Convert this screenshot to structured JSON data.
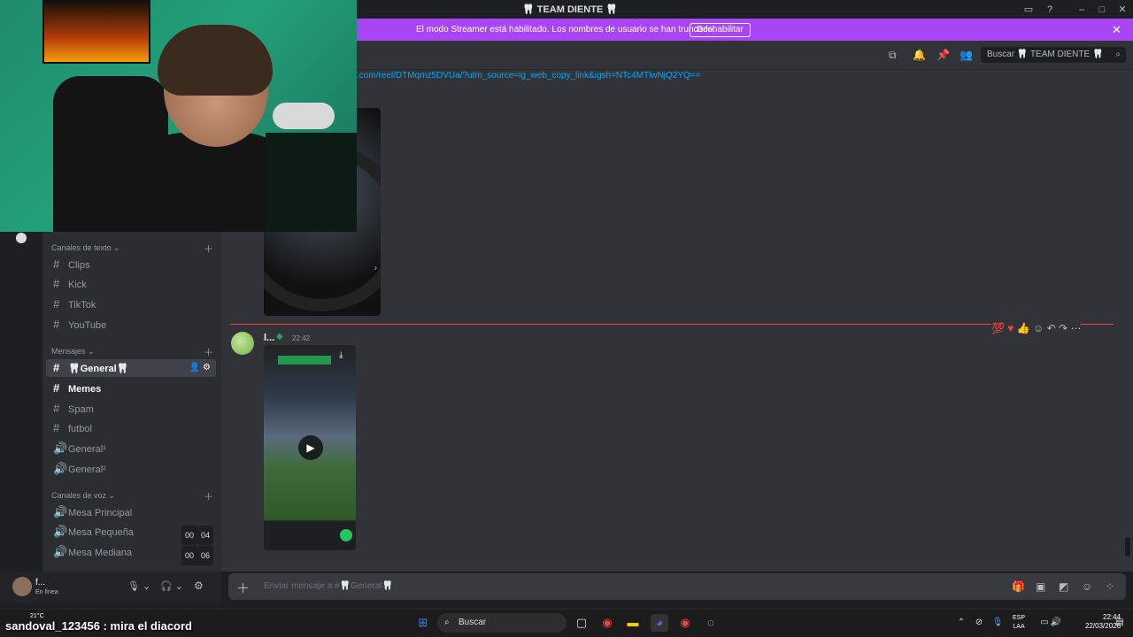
{
  "window": {
    "title": "🦷 TEAM DIENTE 🦷"
  },
  "banner": {
    "text": "El modo Streamer está habilitado. Los nombres de usuario se han truncado.",
    "button": "Deshabilitar"
  },
  "header": {
    "search_placeholder": "Buscar 🦷 TEAM DIENTE 🦷"
  },
  "sidebar": {
    "cat_text": "Canales de texto",
    "text_channels": [
      "Clips",
      "Kick",
      "TikTok",
      "YouTube"
    ],
    "cat_dm": "Mensajes",
    "dm_channels": [
      "🦷General🦷",
      "Memes",
      "Spam",
      "futbol",
      "General¹",
      "General²"
    ],
    "cat_voice": "Canales de voz",
    "voice_channels": [
      {
        "name": "Mesa Principal",
        "count": ""
      },
      {
        "name": "Mesa Pequeña",
        "count_a": "00",
        "count_b": "04"
      },
      {
        "name": "Mesa Mediana",
        "count_a": "00",
        "count_b": "06"
      }
    ]
  },
  "user": {
    "name": "f...",
    "status": "En línea"
  },
  "chat": {
    "link": ".com/reel/DTMqmz5DVUa/?utm_source=ig_web_copy_link&igsh=NTc4MTlwNjQ2YQ==",
    "author": "l...",
    "time": "22:42",
    "composer_placeholder": "Enviar mensaje a #🦷General🦷"
  },
  "taskbar": {
    "search": "Buscar",
    "weather": "21°C",
    "lang_top": "ESP",
    "lang_bottom": "LAA",
    "time": "22:44",
    "date": "22/03/2026"
  },
  "stream_overlay": "sandoval_123456 : mira el diacord",
  "colors": {
    "banner": "#a845f5",
    "link": "#00a8fc",
    "divider": "#f23f43"
  }
}
